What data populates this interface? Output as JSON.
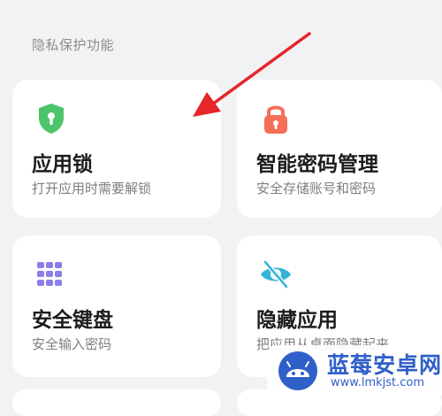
{
  "section": {
    "title": "隐私保护功能"
  },
  "cards": [
    {
      "title": "应用锁",
      "subtitle": "打开应用时需要解锁",
      "icon": "shield-icon",
      "color": "#4cc46b"
    },
    {
      "title": "智能密码管理",
      "subtitle": "安全存储账号和密码",
      "icon": "lock-icon",
      "color": "#f56f57"
    },
    {
      "title": "安全键盘",
      "subtitle": "安全输入密码",
      "icon": "keyboard-icon",
      "color": "#8a7ee8"
    },
    {
      "title": "隐藏应用",
      "subtitle": "把应用从桌面隐藏起来",
      "icon": "eye-slash-icon",
      "color": "#35b3d8"
    }
  ],
  "annotation": {
    "arrow_color": "#e5262a"
  },
  "watermark": {
    "name": "蓝莓安卓网",
    "url": "www.lmkjst.com",
    "color": "#2f5fc8"
  }
}
